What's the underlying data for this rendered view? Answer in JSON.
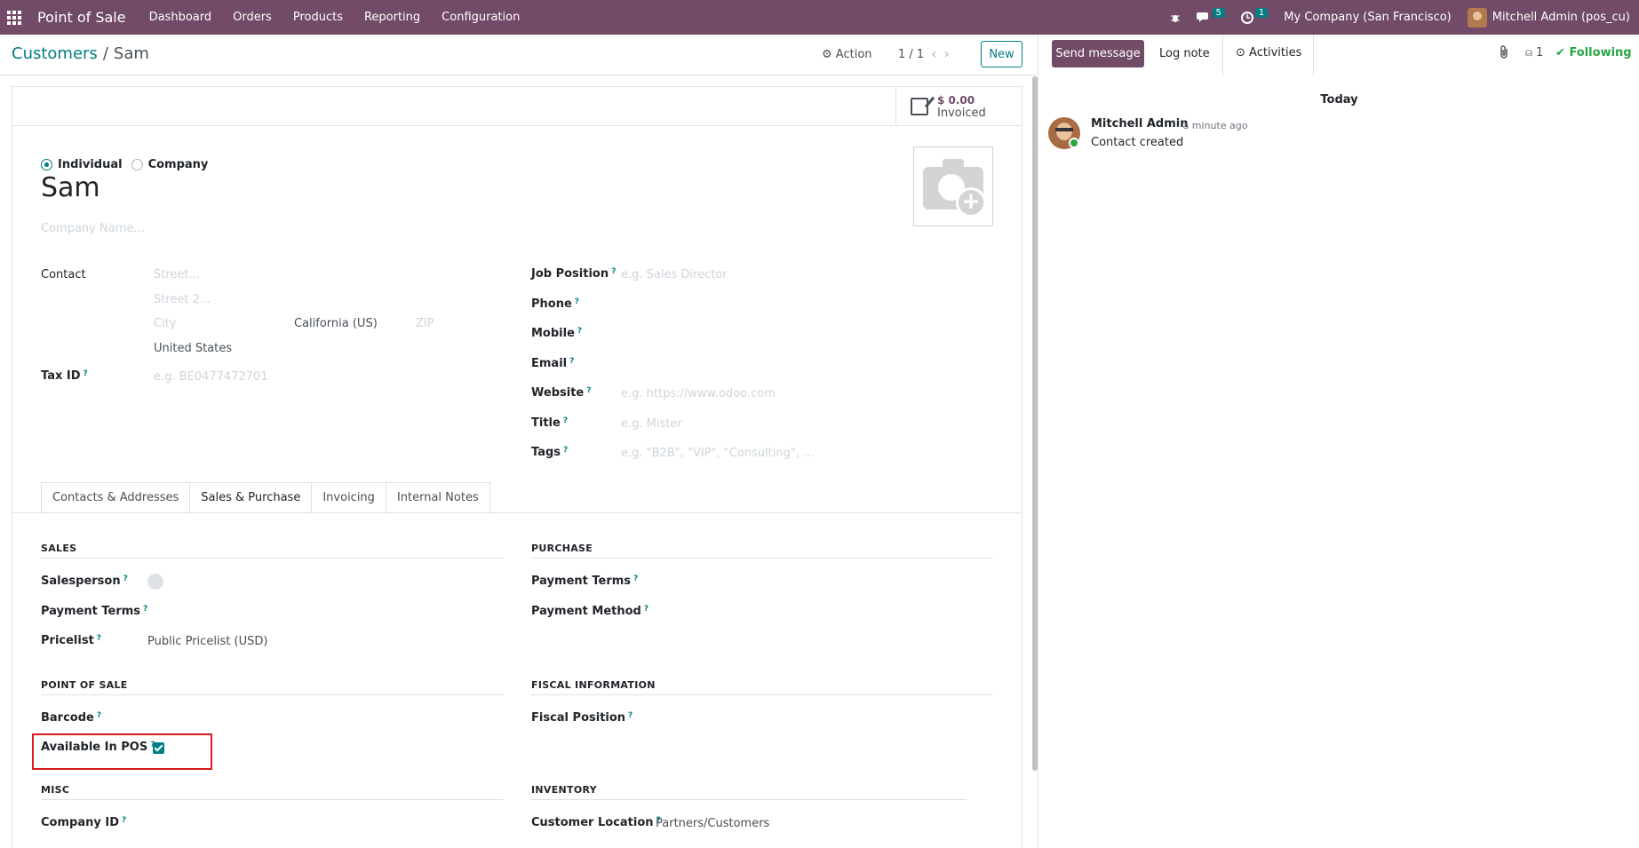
{
  "navbar": {
    "brand": "Point of Sale",
    "menu": [
      "Dashboard",
      "Orders",
      "Products",
      "Reporting",
      "Configuration"
    ],
    "messages_count": "5",
    "activities_count": "1",
    "company": "My Company (San Francisco)",
    "user": "Mitchell Admin (pos_cu)"
  },
  "control": {
    "breadcrumb_parent": "Customers",
    "breadcrumb_sep": "/",
    "breadcrumb_current": "Sam",
    "action_label": "Action",
    "pager": "1 / 1",
    "new_label": "New"
  },
  "stat": {
    "value": "$ 0.00",
    "label": "Invoiced"
  },
  "form": {
    "type_individual": "Individual",
    "type_company": "Company",
    "name": "Sam",
    "company_placeholder": "Company Name...",
    "contact_label": "Contact",
    "street_ph": "Street...",
    "street2_ph": "Street 2...",
    "city_ph": "City",
    "state": "California (US)",
    "zip_ph": "ZIP",
    "country": "United States",
    "taxid_label": "Tax ID",
    "taxid_ph": "e.g. BE0477472701",
    "job_label": "Job Position",
    "job_ph": "e.g. Sales Director",
    "phone_label": "Phone",
    "mobile_label": "Mobile",
    "email_label": "Email",
    "website_label": "Website",
    "website_ph": "e.g. https://www.odoo.com",
    "title_label": "Title",
    "title_ph": "e.g. Mister",
    "tags_label": "Tags",
    "tags_ph": "e.g. \"B2B\", \"VIP\", \"Consulting\", ...",
    "q": "?"
  },
  "tabs": [
    "Contacts & Addresses",
    "Sales & Purchase",
    "Invoicing",
    "Internal Notes"
  ],
  "sales": {
    "title": "SALES",
    "salesperson": "Salesperson",
    "payment_terms": "Payment Terms",
    "pricelist": "Pricelist",
    "pricelist_value": "Public Pricelist (USD)"
  },
  "purchase": {
    "title": "PURCHASE",
    "payment_terms": "Payment Terms",
    "payment_method": "Payment Method"
  },
  "pos": {
    "title": "POINT OF SALE",
    "barcode": "Barcode",
    "available": "Available In POS"
  },
  "fiscal": {
    "title": "FISCAL INFORMATION",
    "position": "Fiscal Position"
  },
  "misc": {
    "title": "MISC",
    "company_id": "Company ID"
  },
  "inventory": {
    "title": "INVENTORY",
    "customer_location": "Customer Location",
    "customer_location_value": "Partners/Customers"
  },
  "chatter": {
    "send_message": "Send message",
    "log_note": "Log note",
    "activities": "Activities",
    "followers": "1",
    "following": "Following",
    "today": "Today",
    "author": "Mitchell Admin",
    "time": "- a minute ago",
    "body": "Contact created"
  }
}
